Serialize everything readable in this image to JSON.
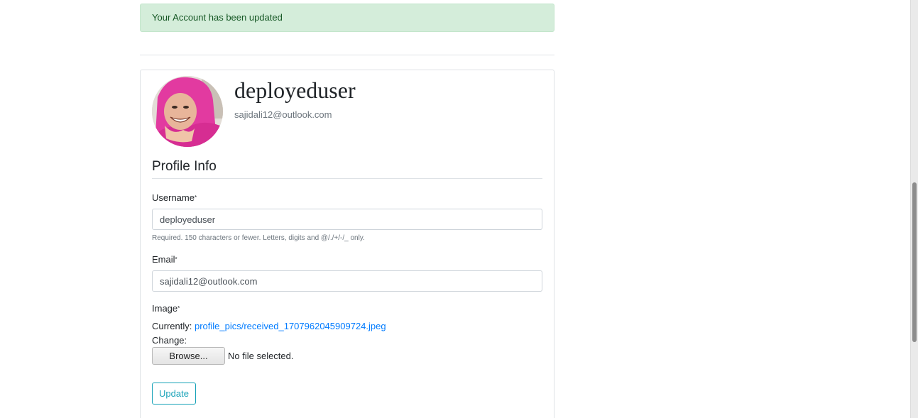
{
  "alert": {
    "message": "Your Account has been updated"
  },
  "profile": {
    "username": "deployeduser",
    "email": "sajidali12@outlook.com"
  },
  "form": {
    "legend": "Profile Info",
    "required_marker": "*",
    "username": {
      "label": "Username",
      "value": "deployeduser",
      "help": "Required. 150 characters or fewer. Letters, digits and @/./+/-/_ only."
    },
    "email": {
      "label": "Email",
      "value": "sajidali12@outlook.com"
    },
    "image": {
      "label": "Image",
      "currently_label": "Currently:",
      "current_file": "profile_pics/received_1707962045909724.jpeg",
      "change_label": "Change:",
      "browse_label": "Browse...",
      "no_file_text": "No file selected."
    },
    "submit_label": "Update"
  },
  "colors": {
    "alert_bg": "#d4edda",
    "alert_text": "#155724",
    "link": "#007bff",
    "update_button": "#17a2b8"
  },
  "icons": {
    "avatar": "profile-photo"
  }
}
